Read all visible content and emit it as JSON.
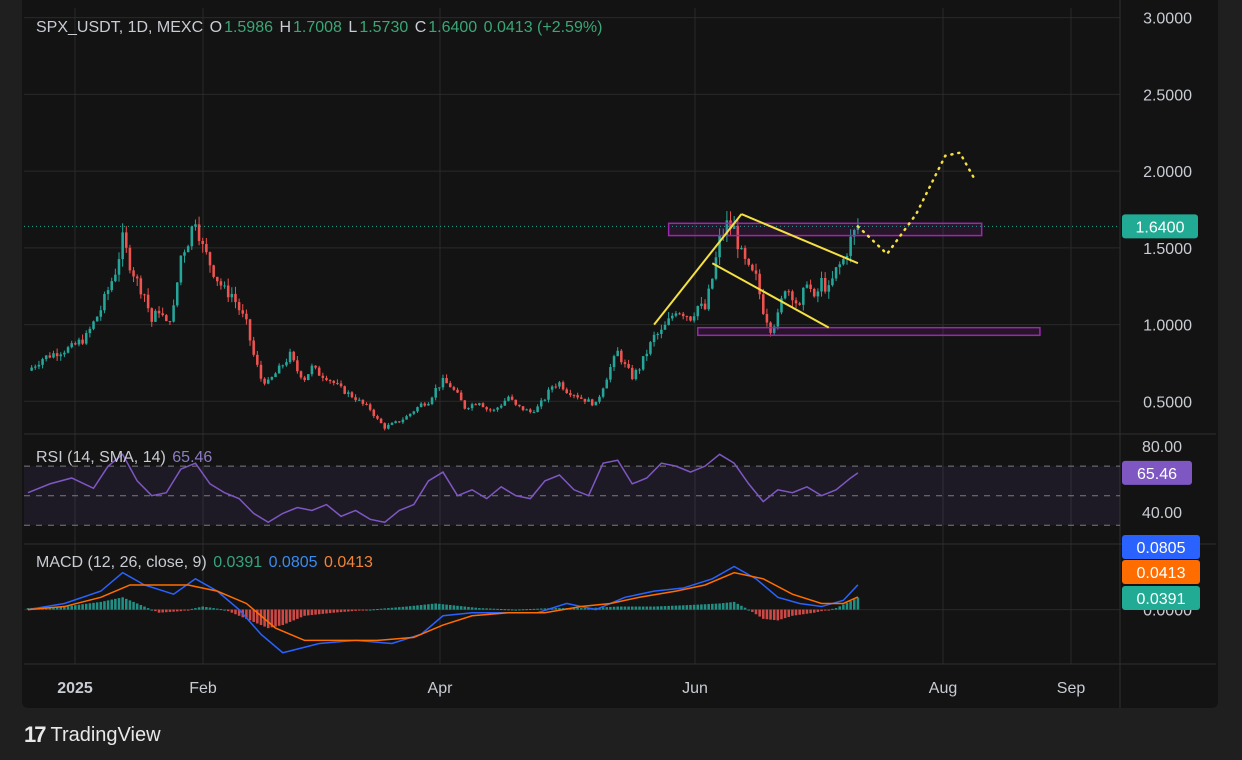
{
  "header": {
    "symbol": "SPX_USDT, 1D, MEXC",
    "o_label": "O",
    "o": "1.5986",
    "h_label": "H",
    "h": "1.7008",
    "l_label": "L",
    "l": "1.5730",
    "c_label": "C",
    "c": "1.6400",
    "change": "0.0413 (+2.59%)"
  },
  "rsi_header": {
    "label": "RSI (14, SMA, 14)",
    "value": "65.46"
  },
  "macd_header": {
    "label": "MACD (12, 26, close, 9)",
    "histogram": "0.0391",
    "macd": "0.0805",
    "signal": "0.0413"
  },
  "branding": {
    "logo": "17",
    "name": "TradingView"
  },
  "colors": {
    "up": "#26a69a",
    "down": "#ef5350",
    "pattern": "#f5e042",
    "box": "#9c27b0",
    "rsi": "#7e57c2",
    "macd": "#2962ff",
    "signal": "#ff6d00",
    "last": "#22ab94"
  },
  "chart_data": [
    {
      "type": "candlestick",
      "title": "SPX_USDT, 1D, MEXC",
      "x_ticks": [
        "2025",
        "Feb",
        "Apr",
        "Jun",
        "Aug",
        "Sep"
      ],
      "y_ticks": [
        "3.0000",
        "2.5000",
        "2.0000",
        "1.5000",
        "1.0000",
        "0.5000"
      ],
      "ylim": [
        0.3,
        3.05
      ],
      "last_price": 1.64,
      "last_price_label": "1.6400",
      "close_path": [
        [
          0,
          0.7
        ],
        [
          4,
          0.78
        ],
        [
          8,
          0.82
        ],
        [
          12,
          0.85
        ],
        [
          16,
          0.92
        ],
        [
          20,
          1.1
        ],
        [
          24,
          1.35
        ],
        [
          26,
          1.55
        ],
        [
          28,
          1.4
        ],
        [
          30,
          1.28
        ],
        [
          32,
          1.2
        ],
        [
          34,
          1.02
        ],
        [
          36,
          1.1
        ],
        [
          38,
          1.0
        ],
        [
          40,
          1.1
        ],
        [
          42,
          1.45
        ],
        [
          44,
          1.55
        ],
        [
          46,
          1.7
        ],
        [
          48,
          1.5
        ],
        [
          50,
          1.4
        ],
        [
          52,
          1.3
        ],
        [
          54,
          1.22
        ],
        [
          56,
          1.2
        ],
        [
          58,
          1.1
        ],
        [
          60,
          1.0
        ],
        [
          62,
          0.8
        ],
        [
          64,
          0.65
        ],
        [
          66,
          0.62
        ],
        [
          68,
          0.68
        ],
        [
          70,
          0.74
        ],
        [
          72,
          0.8
        ],
        [
          74,
          0.7
        ],
        [
          76,
          0.65
        ],
        [
          78,
          0.72
        ],
        [
          80,
          0.68
        ],
        [
          82,
          0.66
        ],
        [
          84,
          0.62
        ],
        [
          86,
          0.58
        ],
        [
          88,
          0.55
        ],
        [
          90,
          0.52
        ],
        [
          92,
          0.48
        ],
        [
          94,
          0.45
        ],
        [
          96,
          0.38
        ],
        [
          98,
          0.33
        ],
        [
          100,
          0.35
        ],
        [
          102,
          0.37
        ],
        [
          104,
          0.4
        ],
        [
          106,
          0.44
        ],
        [
          108,
          0.48
        ],
        [
          110,
          0.5
        ],
        [
          112,
          0.58
        ],
        [
          114,
          0.63
        ],
        [
          116,
          0.6
        ],
        [
          118,
          0.54
        ],
        [
          120,
          0.46
        ],
        [
          122,
          0.48
        ],
        [
          124,
          0.5
        ],
        [
          126,
          0.45
        ],
        [
          128,
          0.44
        ],
        [
          130,
          0.48
        ],
        [
          132,
          0.53
        ],
        [
          134,
          0.47
        ],
        [
          136,
          0.45
        ],
        [
          138,
          0.43
        ],
        [
          140,
          0.46
        ],
        [
          142,
          0.52
        ],
        [
          144,
          0.6
        ],
        [
          146,
          0.62
        ],
        [
          148,
          0.57
        ],
        [
          150,
          0.55
        ],
        [
          152,
          0.52
        ],
        [
          154,
          0.5
        ],
        [
          156,
          0.48
        ],
        [
          158,
          0.6
        ],
        [
          160,
          0.72
        ],
        [
          162,
          0.82
        ],
        [
          164,
          0.73
        ],
        [
          166,
          0.66
        ],
        [
          168,
          0.72
        ],
        [
          170,
          0.82
        ],
        [
          172,
          0.92
        ],
        [
          174,
          0.95
        ],
        [
          176,
          1.02
        ],
        [
          178,
          1.1
        ],
        [
          180,
          1.08
        ],
        [
          182,
          1.05
        ],
        [
          184,
          1.12
        ],
        [
          186,
          1.1
        ],
        [
          188,
          1.3
        ],
        [
          190,
          1.55
        ],
        [
          192,
          1.65
        ],
        [
          194,
          1.62
        ],
        [
          196,
          1.45
        ],
        [
          198,
          1.35
        ],
        [
          200,
          1.3
        ],
        [
          202,
          1.1
        ],
        [
          204,
          0.98
        ],
        [
          206,
          1.05
        ],
        [
          208,
          1.25
        ],
        [
          210,
          1.2
        ],
        [
          212,
          1.1
        ],
        [
          214,
          1.3
        ],
        [
          216,
          1.15
        ],
        [
          218,
          1.28
        ],
        [
          220,
          1.22
        ],
        [
          222,
          1.35
        ],
        [
          224,
          1.42
        ],
        [
          226,
          1.55
        ],
        [
          228,
          1.64
        ]
      ],
      "pattern_lines": [
        {
          "x": [
            172,
            196
          ],
          "y": [
            1.0,
            1.72
          ]
        },
        {
          "x": [
            196,
            228
          ],
          "y": [
            1.72,
            1.4
          ]
        },
        {
          "x": [
            188,
            220
          ],
          "y": [
            1.4,
            0.98
          ]
        }
      ],
      "resistance_zone": {
        "x": [
          176,
          262
        ],
        "y": [
          1.58,
          1.66
        ]
      },
      "support_zone": {
        "x": [
          184,
          278
        ],
        "y": [
          0.93,
          0.98
        ]
      },
      "projection_path": [
        [
          228,
          1.64
        ],
        [
          236,
          1.46
        ],
        [
          244,
          1.72
        ],
        [
          252,
          2.1
        ],
        [
          256,
          2.12
        ],
        [
          260,
          1.95
        ]
      ]
    },
    {
      "type": "line",
      "title": "RSI (14, SMA, 14)",
      "y_ticks": [
        "80.00",
        "40.00"
      ],
      "bands": [
        70,
        50,
        30
      ],
      "ylim": [
        20,
        85
      ],
      "last_value": 65.46,
      "last_value_label": "65.46",
      "points": [
        [
          0,
          52
        ],
        [
          6,
          58
        ],
        [
          12,
          62
        ],
        [
          18,
          55
        ],
        [
          22,
          70
        ],
        [
          26,
          78
        ],
        [
          30,
          60
        ],
        [
          34,
          50
        ],
        [
          38,
          52
        ],
        [
          42,
          68
        ],
        [
          46,
          72
        ],
        [
          50,
          58
        ],
        [
          54,
          52
        ],
        [
          58,
          48
        ],
        [
          62,
          38
        ],
        [
          66,
          32
        ],
        [
          70,
          38
        ],
        [
          74,
          42
        ],
        [
          78,
          40
        ],
        [
          82,
          44
        ],
        [
          86,
          36
        ],
        [
          90,
          40
        ],
        [
          94,
          34
        ],
        [
          98,
          32
        ],
        [
          102,
          40
        ],
        [
          106,
          44
        ],
        [
          110,
          60
        ],
        [
          114,
          66
        ],
        [
          118,
          50
        ],
        [
          122,
          54
        ],
        [
          126,
          48
        ],
        [
          130,
          56
        ],
        [
          134,
          50
        ],
        [
          138,
          48
        ],
        [
          142,
          60
        ],
        [
          146,
          64
        ],
        [
          150,
          54
        ],
        [
          154,
          50
        ],
        [
          158,
          72
        ],
        [
          162,
          74
        ],
        [
          166,
          58
        ],
        [
          170,
          62
        ],
        [
          174,
          72
        ],
        [
          178,
          70
        ],
        [
          182,
          66
        ],
        [
          186,
          70
        ],
        [
          190,
          78
        ],
        [
          194,
          72
        ],
        [
          198,
          58
        ],
        [
          202,
          46
        ],
        [
          206,
          54
        ],
        [
          210,
          52
        ],
        [
          214,
          56
        ],
        [
          218,
          50
        ],
        [
          222,
          54
        ],
        [
          226,
          62
        ],
        [
          228,
          65.46
        ]
      ]
    },
    {
      "type": "line",
      "title": "MACD (12, 26, close, 9)",
      "y_ticks": [
        "0.0000"
      ],
      "ylim": [
        -0.17,
        0.2
      ],
      "series": [
        {
          "name": "MACD",
          "values": [
            [
              0,
              0
            ],
            [
              10,
              0.02
            ],
            [
              20,
              0.06
            ],
            [
              26,
              0.12
            ],
            [
              32,
              0.08
            ],
            [
              40,
              0.05
            ],
            [
              46,
              0.1
            ],
            [
              52,
              0.06
            ],
            [
              58,
              0.0
            ],
            [
              64,
              -0.08
            ],
            [
              70,
              -0.14
            ],
            [
              80,
              -0.11
            ],
            [
              90,
              -0.1
            ],
            [
              100,
              -0.11
            ],
            [
              108,
              -0.08
            ],
            [
              114,
              -0.02
            ],
            [
              122,
              -0.01
            ],
            [
              130,
              -0.01
            ],
            [
              140,
              -0.01
            ],
            [
              148,
              0.02
            ],
            [
              156,
              0.0
            ],
            [
              164,
              0.04
            ],
            [
              172,
              0.06
            ],
            [
              180,
              0.07
            ],
            [
              188,
              0.1
            ],
            [
              194,
              0.14
            ],
            [
              200,
              0.1
            ],
            [
              206,
              0.04
            ],
            [
              212,
              0.02
            ],
            [
              218,
              0.01
            ],
            [
              224,
              0.03
            ],
            [
              228,
              0.0805
            ]
          ]
        },
        {
          "name": "Signal",
          "values": [
            [
              0,
              0
            ],
            [
              10,
              0.01
            ],
            [
              20,
              0.04
            ],
            [
              28,
              0.08
            ],
            [
              36,
              0.08
            ],
            [
              44,
              0.08
            ],
            [
              52,
              0.06
            ],
            [
              60,
              0.02
            ],
            [
              68,
              -0.06
            ],
            [
              76,
              -0.1
            ],
            [
              86,
              -0.1
            ],
            [
              96,
              -0.1
            ],
            [
              106,
              -0.09
            ],
            [
              114,
              -0.05
            ],
            [
              122,
              -0.02
            ],
            [
              132,
              -0.01
            ],
            [
              142,
              -0.01
            ],
            [
              152,
              0.01
            ],
            [
              160,
              0.02
            ],
            [
              168,
              0.04
            ],
            [
              178,
              0.06
            ],
            [
              186,
              0.08
            ],
            [
              194,
              0.12
            ],
            [
              202,
              0.1
            ],
            [
              210,
              0.05
            ],
            [
              218,
              0.02
            ],
            [
              224,
              0.02
            ],
            [
              228,
              0.0413
            ]
          ]
        },
        {
          "name": "Histogram",
          "values": [
            [
              0,
              0.005
            ],
            [
              10,
              0.01
            ],
            [
              20,
              0.025
            ],
            [
              26,
              0.04
            ],
            [
              30,
              0.02
            ],
            [
              36,
              -0.01
            ],
            [
              42,
              -0.005
            ],
            [
              48,
              0.01
            ],
            [
              54,
              0.0
            ],
            [
              58,
              -0.02
            ],
            [
              62,
              -0.04
            ],
            [
              66,
              -0.06
            ],
            [
              70,
              -0.05
            ],
            [
              76,
              -0.02
            ],
            [
              84,
              -0.01
            ],
            [
              94,
              0.0
            ],
            [
              104,
              0.01
            ],
            [
              112,
              0.02
            ],
            [
              116,
              0.015
            ],
            [
              124,
              0.005
            ],
            [
              134,
              0.0
            ],
            [
              144,
              0.005
            ],
            [
              154,
              0.005
            ],
            [
              162,
              0.01
            ],
            [
              172,
              0.01
            ],
            [
              182,
              0.015
            ],
            [
              190,
              0.02
            ],
            [
              194,
              0.025
            ],
            [
              198,
              0.0
            ],
            [
              202,
              -0.03
            ],
            [
              206,
              -0.035
            ],
            [
              210,
              -0.02
            ],
            [
              216,
              -0.01
            ],
            [
              222,
              0.005
            ],
            [
              228,
              0.0391
            ]
          ]
        }
      ],
      "macd_label": "0.0805",
      "signal_label": "0.0413",
      "histogram_label": "0.0391",
      "zero_label": "0.0000"
    }
  ]
}
